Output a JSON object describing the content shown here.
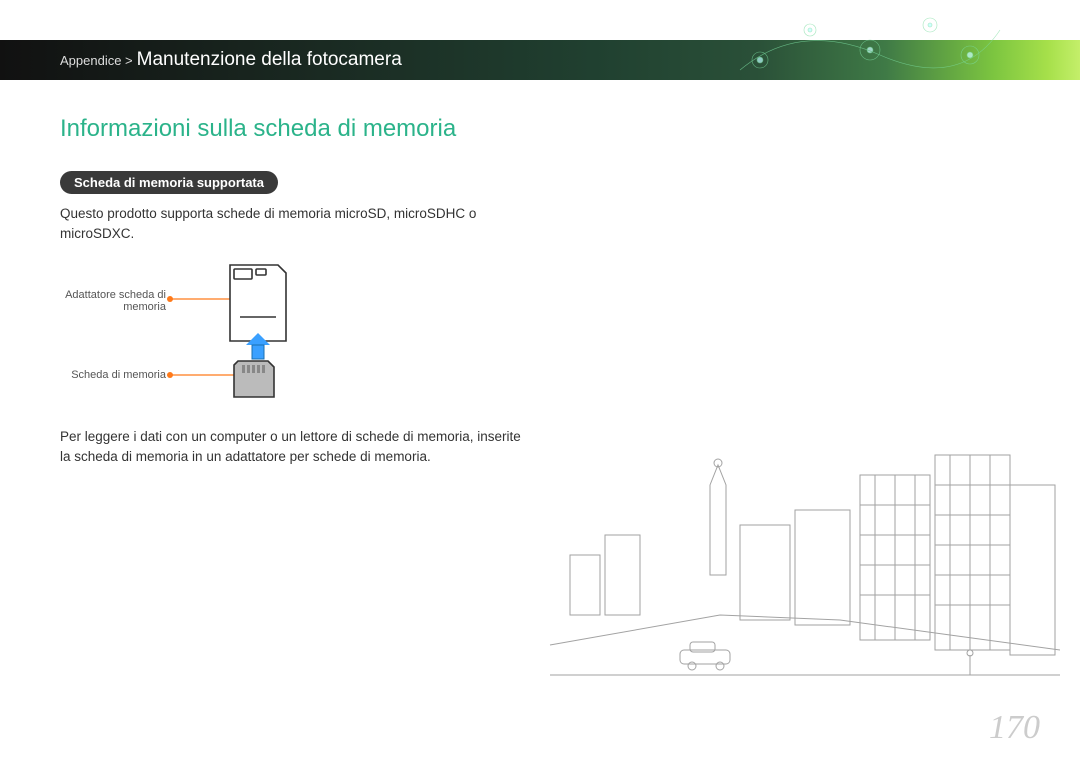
{
  "breadcrumb": {
    "section": "Appendice >",
    "title": "Manutenzione della fotocamera"
  },
  "heading": "Informazioni sulla scheda di memoria",
  "pill_label": "Scheda di memoria supportata",
  "intro_text": "Questo prodotto supporta schede di memoria microSD, microSDHC o microSDXC.",
  "diagram": {
    "label_adapter": "Adattatore scheda di memoria",
    "label_card": "Scheda di memoria"
  },
  "footer_text": "Per leggere i dati con un computer o un lettore di schede di memoria, inserite la scheda di memoria in un adattatore per schede di memoria.",
  "page_number": "170"
}
